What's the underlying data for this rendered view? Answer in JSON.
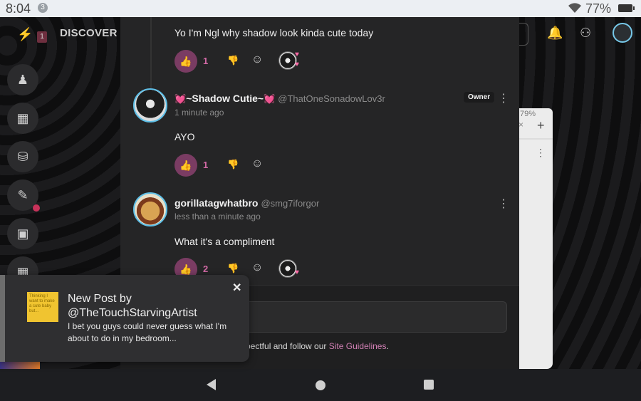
{
  "status_bar": {
    "time": "8:04",
    "notification_badge": "3",
    "battery": "77%"
  },
  "top_nav": {
    "badge": "1",
    "discover": "DISCOVER"
  },
  "right_panel": {
    "pct": "79%"
  },
  "comments": [
    {
      "text": "Yo I'm Ngl why shadow look kinda cute today",
      "likes": "1",
      "has_reactor": true
    },
    {
      "name": "~Shadow Cutie~",
      "handle": "@ThatOneSonadowLov3r",
      "time": "1 minute ago",
      "owner_badge": "Owner",
      "text": "AYO",
      "likes": "1"
    },
    {
      "name": "gorillatagwhatbro",
      "handle": "@smg7iforgor",
      "time": "less than a minute ago",
      "text": "What it's a compliment",
      "likes": "2",
      "has_reactor": true
    }
  ],
  "input": {
    "guidelines_prefix": "spectful and follow our ",
    "guidelines_link": "Site Guidelines",
    "guidelines_suffix": "."
  },
  "toast": {
    "title": "New Post by @TheTouchStarvingArtist",
    "body": "I bet you guys could never guess what I'm about to do in my bedroom...",
    "thumbnail_text": "Thinking I want to make a cute baby but..."
  },
  "colors": {
    "accent": "#7a3c63",
    "link": "#d07fb3",
    "heart": "#ff4f9a",
    "panel": "#252526"
  }
}
